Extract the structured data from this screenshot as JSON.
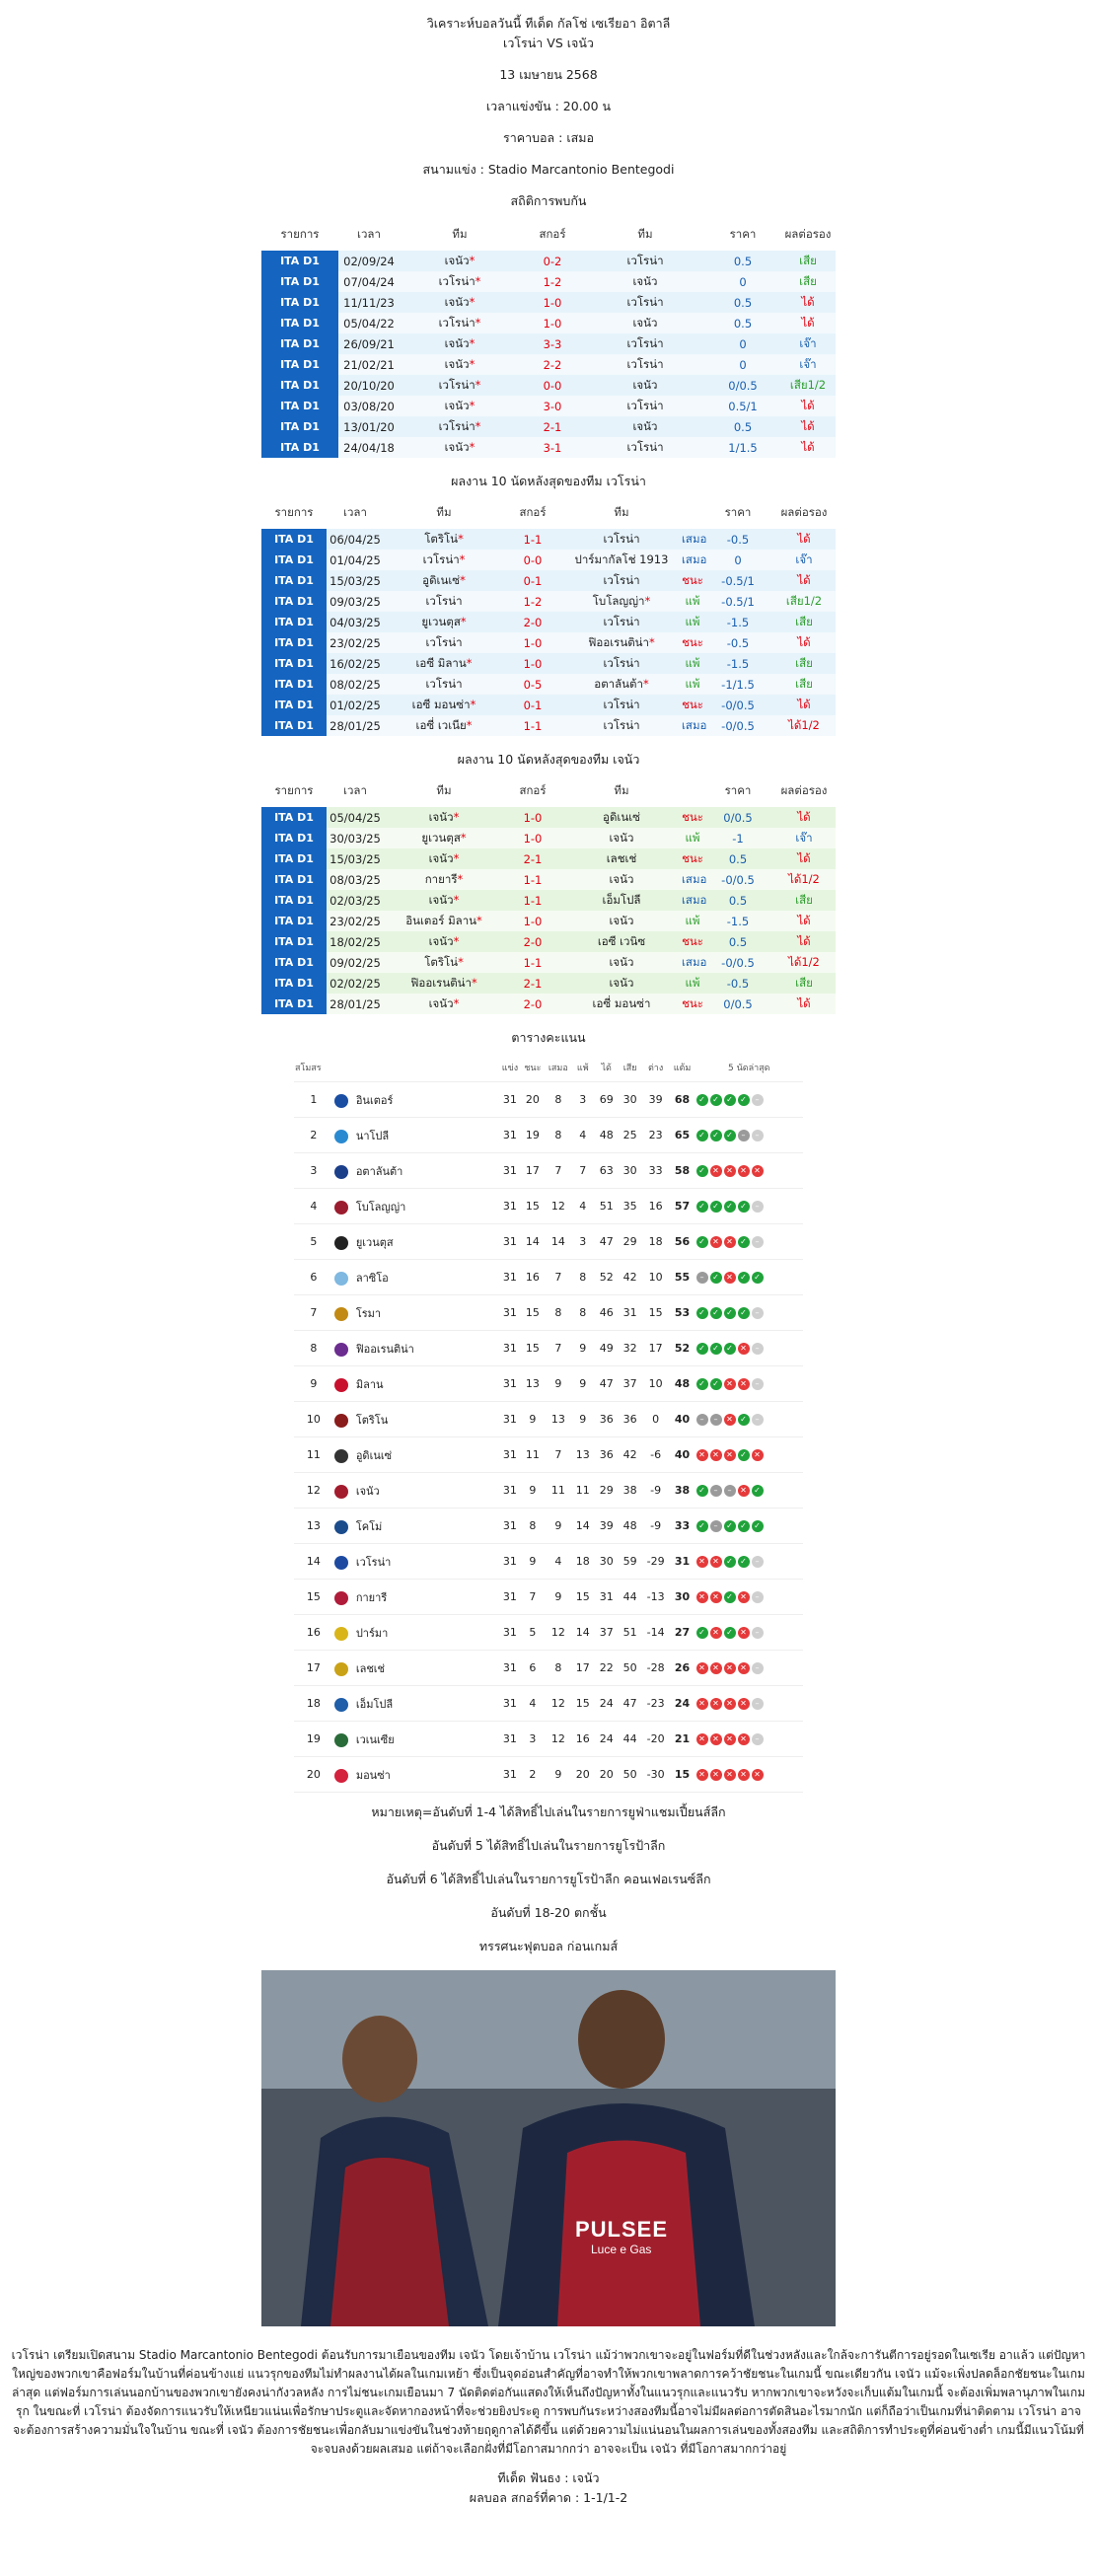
{
  "header": {
    "title": "วิเคราะห์บอลวันนี้ ทีเด็ด กัลโช่ เซเรียอา อิตาลี",
    "match": "เวโรน่า VS เจนัว",
    "date": "13 เมษายน 2568",
    "kickoff": "เวลาแข่งขัน : 20.00 น",
    "price": "ราคาบอล : เสมอ",
    "venue": "สนามแข่ง : Stadio Marcantonio Bentegodi",
    "h2h_title": "สถิติการพบกัน"
  },
  "h2h_columns": [
    "รายการ",
    "เวลา",
    "ทีม",
    "สกอร์",
    "ทีม",
    "ราคา",
    "ผลต่อรอง"
  ],
  "h2h": [
    {
      "league": "ITA D1",
      "date": "02/09/24",
      "home": "เจนัว*",
      "score": "0-2",
      "away": "เวโรน่า",
      "odds": "0.5",
      "result": "เสีย"
    },
    {
      "league": "ITA D1",
      "date": "07/04/24",
      "home": "เวโรน่า*",
      "score": "1-2",
      "away": "เจนัว",
      "odds": "0",
      "result": "เสีย"
    },
    {
      "league": "ITA D1",
      "date": "11/11/23",
      "home": "เจนัว*",
      "score": "1-0",
      "away": "เวโรน่า",
      "odds": "0.5",
      "result": "ได้"
    },
    {
      "league": "ITA D1",
      "date": "05/04/22",
      "home": "เวโรน่า*",
      "score": "1-0",
      "away": "เจนัว",
      "odds": "0.5",
      "result": "ได้"
    },
    {
      "league": "ITA D1",
      "date": "26/09/21",
      "home": "เจนัว*",
      "score": "3-3",
      "away": "เวโรน่า",
      "odds": "0",
      "result": "เจ๊า"
    },
    {
      "league": "ITA D1",
      "date": "21/02/21",
      "home": "เจนัว*",
      "score": "2-2",
      "away": "เวโรน่า",
      "odds": "0",
      "result": "เจ๊า"
    },
    {
      "league": "ITA D1",
      "date": "20/10/20",
      "home": "เวโรน่า*",
      "score": "0-0",
      "away": "เจนัว",
      "odds": "0/0.5",
      "result": "เสีย1/2"
    },
    {
      "league": "ITA D1",
      "date": "03/08/20",
      "home": "เจนัว*",
      "score": "3-0",
      "away": "เวโรน่า",
      "odds": "0.5/1",
      "result": "ได้"
    },
    {
      "league": "ITA D1",
      "date": "13/01/20",
      "home": "เวโรน่า*",
      "score": "2-1",
      "away": "เจนัว",
      "odds": "0.5",
      "result": "ได้"
    },
    {
      "league": "ITA D1",
      "date": "24/04/18",
      "home": "เจนัว*",
      "score": "3-1",
      "away": "เวโรน่า",
      "odds": "1/1.5",
      "result": "ได้"
    }
  ],
  "verona_title": "ผลงาน 10 นัดหลังสุดของทีม เวโรน่า",
  "verona_form": [
    {
      "league": "ITA D1",
      "date": "06/04/25",
      "home": "โตริโน่*",
      "score": "1-1",
      "away": "เวโรน่า",
      "status": "เสมอ",
      "odds": "-0.5",
      "result": "ได้"
    },
    {
      "league": "ITA D1",
      "date": "01/04/25",
      "home": "เวโรน่า*",
      "score": "0-0",
      "away": "ปาร์มากัลโช่ 1913",
      "status": "เสมอ",
      "odds": "0",
      "result": "เจ๊า"
    },
    {
      "league": "ITA D1",
      "date": "15/03/25",
      "home": "อูดิเนเซ่*",
      "score": "0-1",
      "away": "เวโรน่า",
      "status": "ชนะ",
      "odds": "-0.5/1",
      "result": "ได้"
    },
    {
      "league": "ITA D1",
      "date": "09/03/25",
      "home": "เวโรน่า",
      "score": "1-2",
      "away": "โบโลญญ่า*",
      "status": "แพ้",
      "odds": "-0.5/1",
      "result": "เสีย1/2"
    },
    {
      "league": "ITA D1",
      "date": "04/03/25",
      "home": "ยูเวนตุส*",
      "score": "2-0",
      "away": "เวโรน่า",
      "status": "แพ้",
      "odds": "-1.5",
      "result": "เสีย"
    },
    {
      "league": "ITA D1",
      "date": "23/02/25",
      "home": "เวโรน่า",
      "score": "1-0",
      "away": "ฟิออเรนติน่า*",
      "status": "ชนะ",
      "odds": "-0.5",
      "result": "ได้"
    },
    {
      "league": "ITA D1",
      "date": "16/02/25",
      "home": "เอซี มิลาน*",
      "score": "1-0",
      "away": "เวโรน่า",
      "status": "แพ้",
      "odds": "-1.5",
      "result": "เสีย"
    },
    {
      "league": "ITA D1",
      "date": "08/02/25",
      "home": "เวโรน่า",
      "score": "0-5",
      "away": "อตาลันต้า*",
      "status": "แพ้",
      "odds": "-1/1.5",
      "result": "เสีย"
    },
    {
      "league": "ITA D1",
      "date": "01/02/25",
      "home": "เอซี มอนซ่า*",
      "score": "0-1",
      "away": "เวโรน่า",
      "status": "ชนะ",
      "odds": "-0/0.5",
      "result": "ได้"
    },
    {
      "league": "ITA D1",
      "date": "28/01/25",
      "home": "เอซี่ เวเนีย*",
      "score": "1-1",
      "away": "เวโรน่า",
      "status": "เสมอ",
      "odds": "-0/0.5",
      "result": "ได้1/2"
    }
  ],
  "genoa_title": "ผลงาน 10 นัดหลังสุดของทีม เจนัว",
  "genoa_form": [
    {
      "league": "ITA D1",
      "date": "05/04/25",
      "home": "เจนัว*",
      "score": "1-0",
      "away": "อูดิเนเซ่",
      "status": "ชนะ",
      "odds": "0/0.5",
      "result": "ได้"
    },
    {
      "league": "ITA D1",
      "date": "30/03/25",
      "home": "ยูเวนตุส*",
      "score": "1-0",
      "away": "เจนัว",
      "status": "แพ้",
      "odds": "-1",
      "result": "เจ๊า"
    },
    {
      "league": "ITA D1",
      "date": "15/03/25",
      "home": "เจนัว*",
      "score": "2-1",
      "away": "เลชเช่",
      "status": "ชนะ",
      "odds": "0.5",
      "result": "ได้"
    },
    {
      "league": "ITA D1",
      "date": "08/03/25",
      "home": "กายารี*",
      "score": "1-1",
      "away": "เจนัว",
      "status": "เสมอ",
      "odds": "-0/0.5",
      "result": "ได้1/2"
    },
    {
      "league": "ITA D1",
      "date": "02/03/25",
      "home": "เจนัว*",
      "score": "1-1",
      "away": "เอ็มโปลี",
      "status": "เสมอ",
      "odds": "0.5",
      "result": "เสีย"
    },
    {
      "league": "ITA D1",
      "date": "23/02/25",
      "home": "อินเตอร์ มิลาน*",
      "score": "1-0",
      "away": "เจนัว",
      "status": "แพ้",
      "odds": "-1.5",
      "result": "ได้"
    },
    {
      "league": "ITA D1",
      "date": "18/02/25",
      "home": "เจนัว*",
      "score": "2-0",
      "away": "เอซี เวนิซ",
      "status": "ชนะ",
      "odds": "0.5",
      "result": "ได้"
    },
    {
      "league": "ITA D1",
      "date": "09/02/25",
      "home": "โตริโน่*",
      "score": "1-1",
      "away": "เจนัว",
      "status": "เสมอ",
      "odds": "-0/0.5",
      "result": "ได้1/2"
    },
    {
      "league": "ITA D1",
      "date": "02/02/25",
      "home": "ฟิออเรนติน่า*",
      "score": "2-1",
      "away": "เจนัว",
      "status": "แพ้",
      "odds": "-0.5",
      "result": "เสีย"
    },
    {
      "league": "ITA D1",
      "date": "28/01/25",
      "home": "เจนัว*",
      "score": "2-0",
      "away": "เอซี่ มอนซ่า",
      "status": "ชนะ",
      "odds": "0/0.5",
      "result": "ได้"
    }
  ],
  "standings_title": "ตารางคะแนน",
  "standings_columns": [
    "สโมสร",
    "แข่ง",
    "ชนะ",
    "เสมอ",
    "แพ้",
    "ได้",
    "เสีย",
    "ต่าง",
    "แต้ม",
    "5 นัดล่าสุด"
  ],
  "standings": [
    {
      "pos": "1",
      "team": "อินเตอร์",
      "color": "#1a4ea3",
      "p": "31",
      "w": "20",
      "d": "8",
      "l": "3",
      "gf": "69",
      "ga": "30",
      "gd": "39",
      "pts": "68",
      "form": [
        "w",
        "w",
        "w",
        "w",
        "n"
      ]
    },
    {
      "pos": "2",
      "team": "นาโปลี",
      "color": "#2a8ad1",
      "p": "31",
      "w": "19",
      "d": "8",
      "l": "4",
      "gf": "48",
      "ga": "25",
      "gd": "23",
      "pts": "65",
      "form": [
        "w",
        "w",
        "w",
        "d",
        "n"
      ]
    },
    {
      "pos": "3",
      "team": "อตาลันต้า",
      "color": "#1c3f8a",
      "p": "31",
      "w": "17",
      "d": "7",
      "l": "7",
      "gf": "63",
      "ga": "30",
      "gd": "33",
      "pts": "58",
      "form": [
        "w",
        "l",
        "l",
        "l",
        "l"
      ]
    },
    {
      "pos": "4",
      "team": "โบโลญญ่า",
      "color": "#9b1c2e",
      "p": "31",
      "w": "15",
      "d": "12",
      "l": "4",
      "gf": "51",
      "ga": "35",
      "gd": "16",
      "pts": "57",
      "form": [
        "w",
        "w",
        "w",
        "w",
        "n"
      ]
    },
    {
      "pos": "5",
      "team": "ยูเวนตุส",
      "color": "#222222",
      "p": "31",
      "w": "14",
      "d": "14",
      "l": "3",
      "gf": "47",
      "ga": "29",
      "gd": "18",
      "pts": "56",
      "form": [
        "w",
        "l",
        "l",
        "w",
        "n"
      ]
    },
    {
      "pos": "6",
      "team": "ลาซิโอ",
      "color": "#7fb8e0",
      "p": "31",
      "w": "16",
      "d": "7",
      "l": "8",
      "gf": "52",
      "ga": "42",
      "gd": "10",
      "pts": "55",
      "form": [
        "d",
        "w",
        "l",
        "w",
        "w"
      ]
    },
    {
      "pos": "7",
      "team": "โรมา",
      "color": "#c28a13",
      "p": "31",
      "w": "15",
      "d": "8",
      "l": "8",
      "gf": "46",
      "ga": "31",
      "gd": "15",
      "pts": "53",
      "form": [
        "w",
        "w",
        "w",
        "w",
        "n"
      ]
    },
    {
      "pos": "8",
      "team": "ฟิออเรนติน่า",
      "color": "#6b2d8f",
      "p": "31",
      "w": "15",
      "d": "7",
      "l": "9",
      "gf": "49",
      "ga": "32",
      "gd": "17",
      "pts": "52",
      "form": [
        "w",
        "w",
        "w",
        "l",
        "n"
      ]
    },
    {
      "pos": "9",
      "team": "มิลาน",
      "color": "#c8102e",
      "p": "31",
      "w": "13",
      "d": "9",
      "l": "9",
      "gf": "47",
      "ga": "37",
      "gd": "10",
      "pts": "48",
      "form": [
        "w",
        "w",
        "l",
        "l",
        "n"
      ]
    },
    {
      "pos": "10",
      "team": "โตริโน",
      "color": "#8a1c1c",
      "p": "31",
      "w": "9",
      "d": "13",
      "l": "9",
      "gf": "36",
      "ga": "36",
      "gd": "0",
      "pts": "40",
      "form": [
        "d",
        "d",
        "l",
        "w",
        "n"
      ]
    },
    {
      "pos": "11",
      "team": "อูดิเนเซ่",
      "color": "#333333",
      "p": "31",
      "w": "11",
      "d": "7",
      "l": "13",
      "gf": "36",
      "ga": "42",
      "gd": "-6",
      "pts": "40",
      "form": [
        "l",
        "l",
        "l",
        "w",
        "l"
      ]
    },
    {
      "pos": "12",
      "team": "เจนัว",
      "color": "#a31c2e",
      "p": "31",
      "w": "9",
      "d": "11",
      "l": "11",
      "gf": "29",
      "ga": "38",
      "gd": "-9",
      "pts": "38",
      "form": [
        "w",
        "d",
        "d",
        "l",
        "w"
      ]
    },
    {
      "pos": "13",
      "team": "โคโม่",
      "color": "#1b4c8c",
      "p": "31",
      "w": "8",
      "d": "9",
      "l": "14",
      "gf": "39",
      "ga": "48",
      "gd": "-9",
      "pts": "33",
      "form": [
        "w",
        "d",
        "w",
        "w",
        "w"
      ]
    },
    {
      "pos": "14",
      "team": "เวโรน่า",
      "color": "#1d4aa0",
      "p": "31",
      "w": "9",
      "d": "4",
      "l": "18",
      "gf": "30",
      "ga": "59",
      "gd": "-29",
      "pts": "31",
      "form": [
        "l",
        "l",
        "w",
        "w",
        "n"
      ]
    },
    {
      "pos": "15",
      "team": "กายารี",
      "color": "#b01c3a",
      "p": "31",
      "w": "7",
      "d": "9",
      "l": "15",
      "gf": "31",
      "ga": "44",
      "gd": "-13",
      "pts": "30",
      "form": [
        "l",
        "l",
        "w",
        "l",
        "n"
      ]
    },
    {
      "pos": "16",
      "team": "ปาร์มา",
      "color": "#d9b51a",
      "p": "31",
      "w": "5",
      "d": "12",
      "l": "14",
      "gf": "37",
      "ga": "51",
      "gd": "-14",
      "pts": "27",
      "form": [
        "w",
        "l",
        "w",
        "l",
        "n"
      ]
    },
    {
      "pos": "17",
      "team": "เลชเช่",
      "color": "#caa217",
      "p": "31",
      "w": "6",
      "d": "8",
      "l": "17",
      "gf": "22",
      "ga": "50",
      "gd": "-28",
      "pts": "26",
      "form": [
        "l",
        "l",
        "l",
        "l",
        "n"
      ]
    },
    {
      "pos": "18",
      "team": "เอ็มโปลี",
      "color": "#1f5ea8",
      "p": "31",
      "w": "4",
      "d": "12",
      "l": "15",
      "gf": "24",
      "ga": "47",
      "gd": "-23",
      "pts": "24",
      "form": [
        "l",
        "l",
        "l",
        "l",
        "n"
      ]
    },
    {
      "pos": "19",
      "team": "เวเนเซีย",
      "color": "#2a6b3a",
      "p": "31",
      "w": "3",
      "d": "12",
      "l": "16",
      "gf": "24",
      "ga": "44",
      "gd": "-20",
      "pts": "21",
      "form": [
        "l",
        "l",
        "l",
        "l",
        "n"
      ]
    },
    {
      "pos": "20",
      "team": "มอนซ่า",
      "color": "#d4213d",
      "p": "31",
      "w": "2",
      "d": "9",
      "l": "20",
      "gf": "20",
      "ga": "50",
      "gd": "-30",
      "pts": "15",
      "form": [
        "l",
        "l",
        "l",
        "l",
        "l"
      ]
    }
  ],
  "notes": [
    "หมายเหตุ=อันดับที่ 1-4 ได้สิทธิ์ไปเล่นในรายการยูฟ่าแชมเปี้ยนส์ลีก",
    "อันดับที่ 5 ได้สิทธิ์ไปเล่นในรายการยูโรป้าลีก",
    "อันดับที่ 6 ได้สิทธิ์ไปเล่นในรายการยูโรป้าลีก คอนเฟอเรนซ์ลีก",
    "อันดับที่ 18-20 ตกชั้น",
    "ทรรศนะฟุตบอล ก่อนเกมส์"
  ],
  "photo": {
    "sponsor": "PULSEE",
    "sponsor_sub": "Luce e Gas"
  },
  "analysis": "เวโรน่า เตรียมเปิดสนาม Stadio Marcantonio Bentegodi ต้อนรับการมาเยือนของทีม เจนัว โดยเจ้าบ้าน เวโรน่า แม้ว่าพวกเขาจะอยู่ในฟอร์มที่ดีในช่วงหลังและใกล้จะการันตีการอยู่รอดในเซเรีย อาแล้ว แต่ปัญหาใหญ่ของพวกเขาคือฟอร์มในบ้านที่ค่อนข้างแย่ แนวรุกของทีมไม่ทำผลงานได้ผลในเกมเหย้า ซึ่งเป็นจุดอ่อนสำคัญที่อาจทำให้พวกเขาพลาดการคว้าชัยชนะในเกมนี้ ขณะเดียวกัน เจนัว แม้จะเพิ่งปลดล็อกชัยชนะในเกมล่าสุด แต่ฟอร์มการเล่นนอกบ้านของพวกเขายังคงน่ากังวลหลัง การไม่ชนะเกมเยือนมา 7 นัดติดต่อกันแสดงให้เห็นถึงปัญหาทั้งในแนวรุกและแนวรับ หากพวกเขาจะหวังจะเก็บแต้มในเกมนี้ จะต้องเพิ่มพลานุภาพในเกมรุก ในขณะที่ เวโรน่า ต้องจัดการแนวรับให้เหนียวแน่นเพื่อรักษาประตูและจัดหากองหน้าที่จะช่วยยิงประตู การพบกันระหว่างสองทีมนี้อาจไม่มีผลต่อการตัดสินอะไรมากนัก แต่ก็ถือว่าเป็นเกมที่น่าติดตาม เวโรน่า อาจจะต้องการสร้างความมั่นใจในบ้าน ขณะที่ เจนัว ต้องการชัยชนะเพื่อกลับมาแข่งขันในช่วงท้ายฤดูกาลได้ดีขึ้น แต่ด้วยความไม่แน่นอนในผลการเล่นของทั้งสองทีม และสถิติการทำประตูที่ค่อนข้างต่ำ เกมนี้มีแนวโน้มที่จะจบลงด้วยผลเสมอ แต่ถ้าจะเลือกฝั่งที่มีโอกาสมากกว่า อาจจะเป็น เจนัว ที่มีโอกาสมากกว่าอยู่",
  "pick": "ทีเด็ด ฟันธง : เจนัว",
  "predicted": "ผลบอล สกอร์ที่คาด : 1-1/1-2"
}
